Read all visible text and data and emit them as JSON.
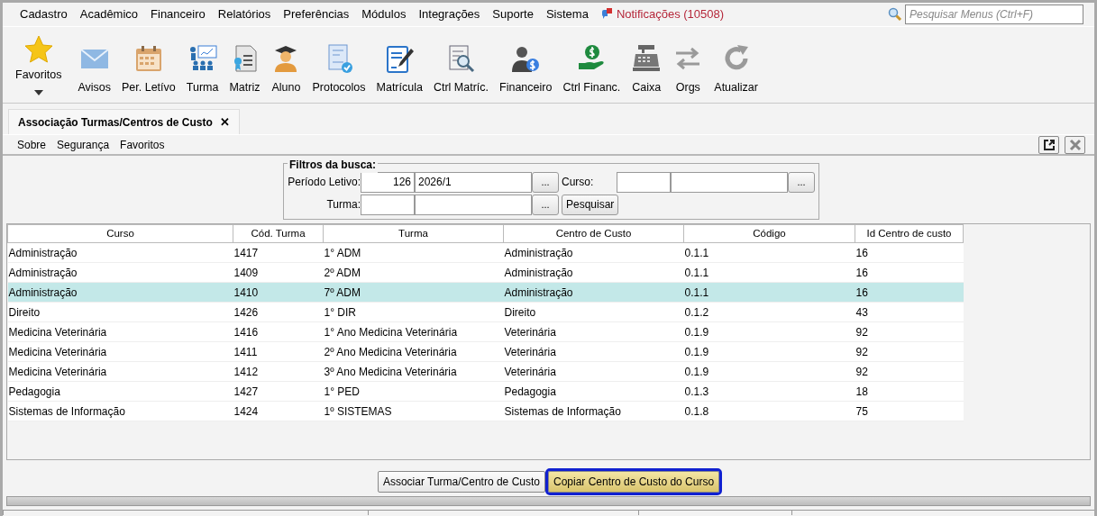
{
  "menu": [
    "Cadastro",
    "Acadêmico",
    "Financeiro",
    "Relatórios",
    "Preferências",
    "Módulos",
    "Integrações",
    "Suporte",
    "Sistema"
  ],
  "notifications": "Notificações (10508)",
  "menu_search": {
    "placeholder": "Pesquisar Menus (Ctrl+F)"
  },
  "toolbar": [
    {
      "label": "Favoritos",
      "kind": "dropdown"
    },
    {
      "label": "Avisos",
      "kind": "plain"
    },
    {
      "label": "Per. Letívo",
      "kind": "plain"
    },
    {
      "label": "Turma",
      "kind": "plain"
    },
    {
      "label": "Matriz",
      "kind": "plain"
    },
    {
      "label": "Aluno",
      "kind": "plain"
    },
    {
      "label": "Protocolos",
      "kind": "plain"
    },
    {
      "label": "Matrícula",
      "kind": "plain"
    },
    {
      "label": "Ctrl Matríc.",
      "kind": "plain"
    },
    {
      "label": "Financeiro",
      "kind": "plain"
    },
    {
      "label": "Ctrl Financ.",
      "kind": "plain"
    },
    {
      "label": "Caixa",
      "kind": "plain"
    },
    {
      "label": "Orgs",
      "kind": "plain"
    },
    {
      "label": "Atualizar",
      "kind": "plain"
    }
  ],
  "tabs": [
    {
      "label": "Associação Turmas/Centros de Custo",
      "selected": true,
      "close": "✕"
    }
  ],
  "submenu": [
    "Sobre",
    "Segurança",
    "Favoritos"
  ],
  "filters": {
    "title": "Filtros da busca:",
    "periodo": {
      "label": "Período Letivo:",
      "code": "126",
      "value": "2026/1",
      "button": "..."
    },
    "curso": {
      "label": "Curso:",
      "button": "..."
    },
    "turma": {
      "label": "Turma:",
      "button": "..."
    },
    "search_button": "Pesquisar"
  },
  "table": {
    "columns": [
      "Curso",
      "Cód. Turma",
      "Turma",
      "Centro de Custo",
      "Código",
      "Id Centro de custo"
    ],
    "rows": [
      {
        "cells": [
          "Administração",
          "1417",
          "1° ADM",
          "Administração",
          "0.1.1",
          "16"
        ],
        "selected": false
      },
      {
        "cells": [
          "Administração",
          "1409",
          "2º ADM",
          "Administração",
          "0.1.1",
          "16"
        ],
        "selected": false
      },
      {
        "cells": [
          "Administração",
          "1410",
          "7º ADM",
          "Administração",
          "0.1.1",
          "16"
        ],
        "selected": true
      },
      {
        "cells": [
          "Direito",
          "1426",
          "1° DIR",
          "Direito",
          "0.1.2",
          "43"
        ],
        "selected": false
      },
      {
        "cells": [
          "Medicina Veterinária",
          "1416",
          "1°  Ano Medicina Veterinária",
          "Veterinária",
          "0.1.9",
          "92"
        ],
        "selected": false
      },
      {
        "cells": [
          "Medicina Veterinária",
          "1411",
          "2º Ano Medicina Veterinária",
          "Veterinária",
          "0.1.9",
          "92"
        ],
        "selected": false
      },
      {
        "cells": [
          "Medicina Veterinária",
          "1412",
          "3º Ano Medicina Veterinária",
          "Veterinária",
          "0.1.9",
          "92"
        ],
        "selected": false
      },
      {
        "cells": [
          "Pedagogia",
          "1427",
          "1° PED",
          "Pedagogia",
          "0.1.3",
          "18"
        ],
        "selected": false
      },
      {
        "cells": [
          "Sistemas de Informação",
          "1424",
          "1º SISTEMAS",
          "Sistemas de Informação",
          "0.1.8",
          "75"
        ],
        "selected": false
      }
    ]
  },
  "actions": [
    {
      "label": "Associar Turma/Centro de Custo",
      "focused": false
    },
    {
      "label": "Copiar Centro de Custo do Curso",
      "focused": true
    }
  ]
}
